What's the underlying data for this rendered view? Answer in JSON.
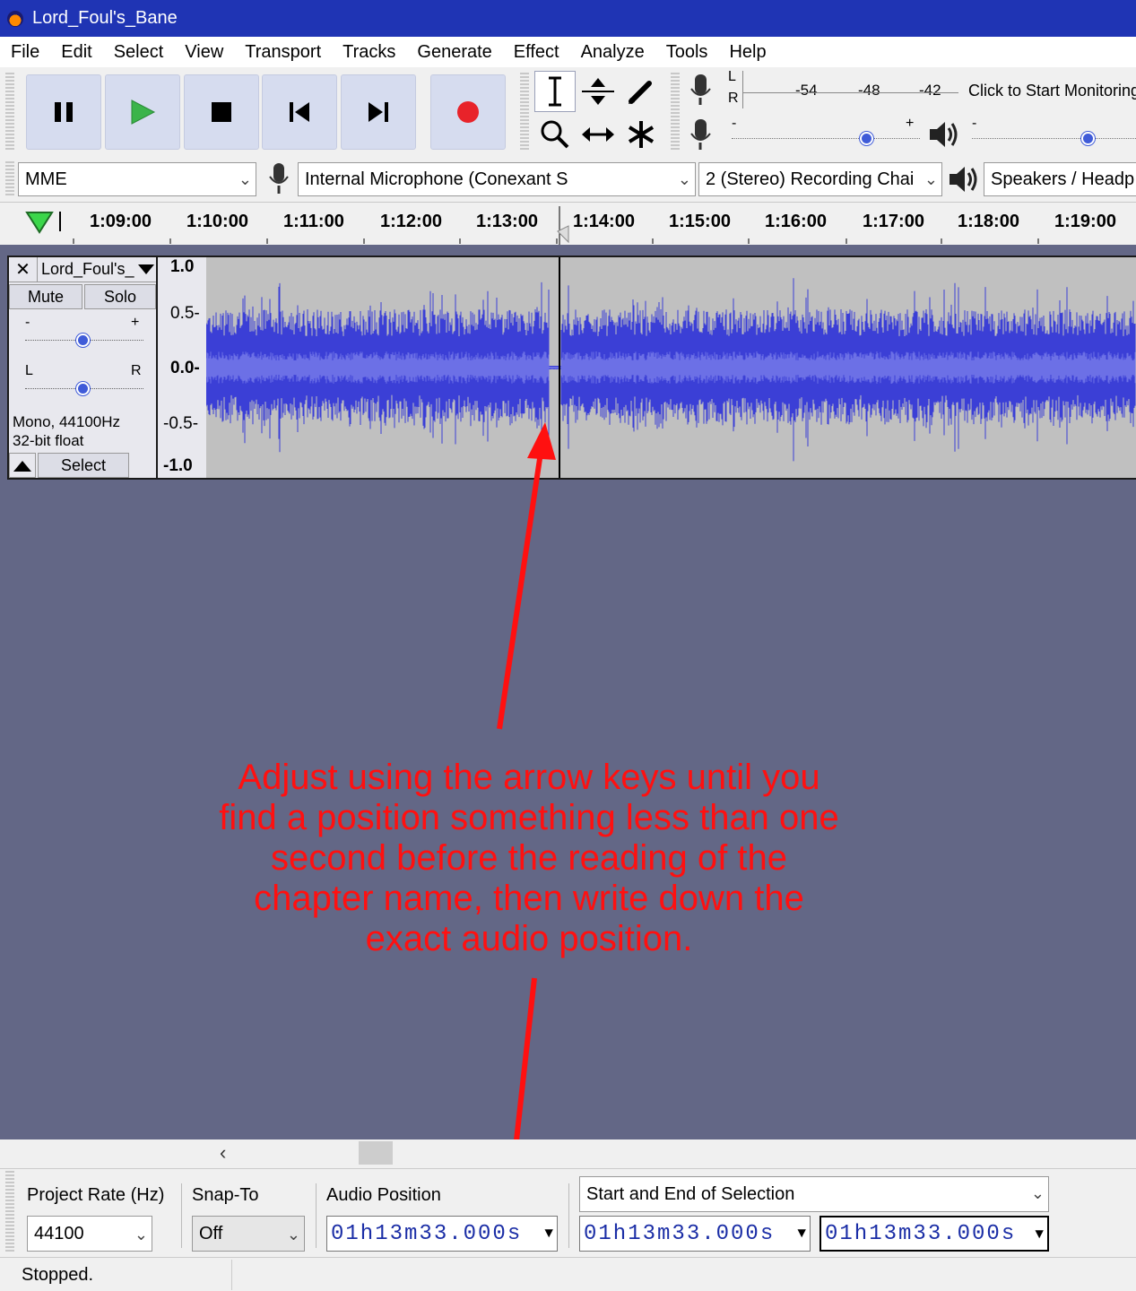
{
  "window": {
    "title": "Lord_Foul's_Bane"
  },
  "menu": [
    "File",
    "Edit",
    "Select",
    "View",
    "Transport",
    "Tracks",
    "Generate",
    "Effect",
    "Analyze",
    "Tools",
    "Help"
  ],
  "meter": {
    "lr": [
      "L",
      "R"
    ],
    "ticks": [
      "-54",
      "-48",
      "-42"
    ],
    "monitor_text": "Click to Start Monitoring",
    "minus": "-",
    "plus": "+"
  },
  "devices": {
    "host": "MME",
    "recording_device": "Internal Microphone (Conexant S",
    "channels": "2 (Stereo) Recording Chai",
    "playback_device": "Speakers / Headp"
  },
  "timeline": {
    "labels": [
      "1:09:00",
      "1:10:00",
      "1:11:00",
      "1:12:00",
      "1:13:00",
      "1:14:00",
      "1:15:00",
      "1:16:00",
      "1:17:00",
      "1:18:00",
      "1:19:00"
    ]
  },
  "track": {
    "name": "Lord_Foul's_",
    "mute": "Mute",
    "solo": "Solo",
    "gain_minus": "-",
    "gain_plus": "+",
    "pan_left": "L",
    "pan_right": "R",
    "info_line1": "Mono, 44100Hz",
    "info_line2": "32-bit float",
    "select": "Select",
    "scale": [
      "1.0",
      "0.5-",
      "0.0-",
      "-0.5-",
      "-1.0"
    ]
  },
  "annotation": "Adjust using the arrow keys until you find a position something less than one second before the reading of the chapter name, then write down the exact audio position.",
  "selection_toolbar": {
    "project_rate_label": "Project Rate (Hz)",
    "project_rate_value": "44100",
    "snap_label": "Snap-To",
    "snap_value": "Off",
    "audio_position_label": "Audio Position",
    "audio_position_value": "01h13m33.000s",
    "selection_mode": "Start and End of Selection",
    "selection_start": "01h13m33.000s",
    "selection_end": "01h13m33.000s"
  },
  "status": {
    "text": "Stopped."
  },
  "colors": {
    "titlebar": "#1f34b4",
    "track_bg": "#636786",
    "wave": "#3b3fd6",
    "annotation": "#ff1010",
    "play": "#3bb44a",
    "record": "#e8232a"
  }
}
